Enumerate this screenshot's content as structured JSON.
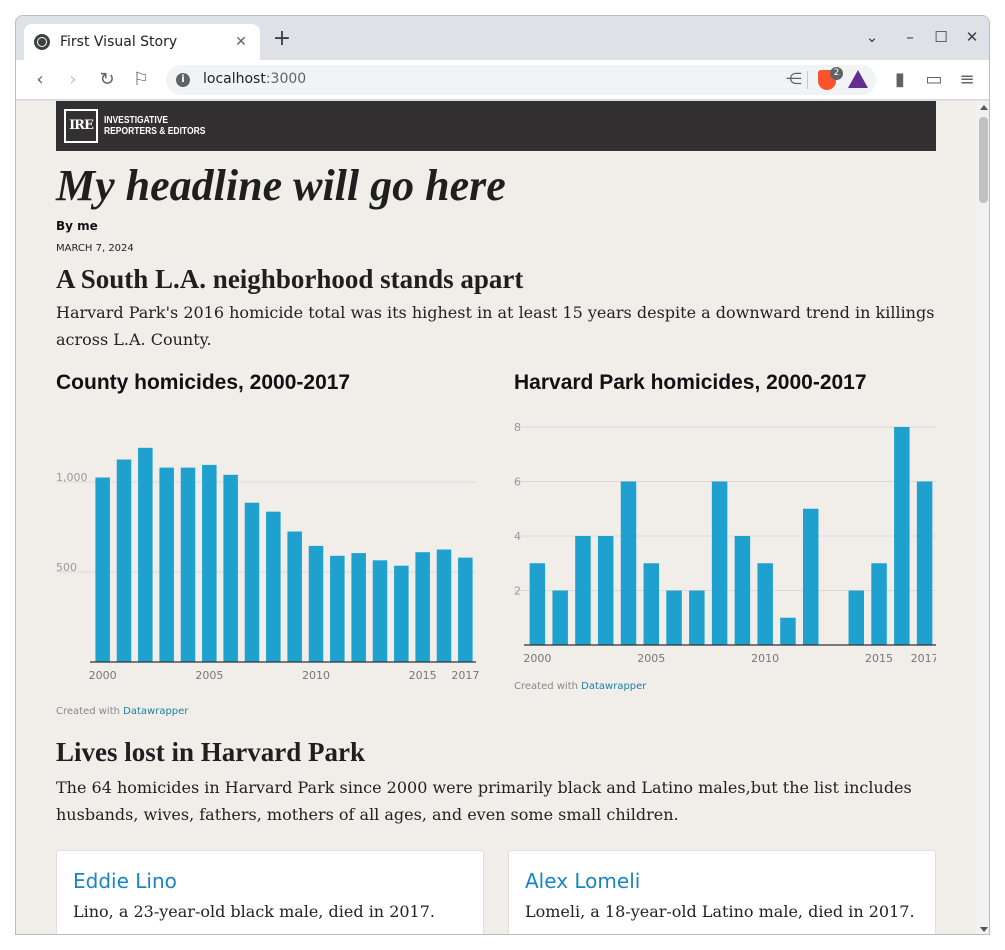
{
  "browser": {
    "tab_title": "First Visual Story",
    "tab_close": "✕",
    "new_tab": "+",
    "url_host": "localhost",
    "url_port": ":3000",
    "brave_badge": "2"
  },
  "masthead": {
    "logo_mark": "IRE",
    "logo_line1": "INVESTIGATIVE",
    "logo_line2": "REPORTERS & EDITORS"
  },
  "article": {
    "headline": "My headline will go here",
    "byline": "By me",
    "date": "MARCH 7, 2024",
    "section1_title": "A South L.A. neighborhood stands apart",
    "section1_text": "Harvard Park's 2016 homicide total was its highest in at least 15 years despite a downward trend in killings across L.A. County.",
    "section2_title": "Lives lost in Harvard Park",
    "section2_text": "The 64 homicides in Harvard Park since 2000 were primarily black and Latino males,but the list includes husbands, wives, fathers, mothers of all ages, and even some small children."
  },
  "credit": {
    "prefix": "Created with ",
    "link": "Datawrapper"
  },
  "cards": [
    {
      "name": "Eddie Lino",
      "desc": "Lino, a 23-year-old black male, died in 2017."
    },
    {
      "name": "Alex Lomeli",
      "desc": "Lomeli, a 18-year-old Latino male, died in 2017."
    }
  ],
  "colors": {
    "bar": "#1fa1cf",
    "page_bg": "#f1eeea",
    "masthead_bg": "#333031",
    "link": "#1a85c2"
  },
  "chart_data": [
    {
      "type": "bar",
      "title": "County homicides, 2000-2017",
      "categories": [
        2000,
        2001,
        2002,
        2003,
        2004,
        2005,
        2006,
        2007,
        2008,
        2009,
        2010,
        2011,
        2012,
        2013,
        2014,
        2015,
        2016,
        2017
      ],
      "values": [
        1025,
        1125,
        1190,
        1080,
        1080,
        1095,
        1040,
        885,
        835,
        725,
        645,
        590,
        605,
        565,
        535,
        610,
        625,
        580
      ],
      "x_tick_labels": [
        "2000",
        "2005",
        "2010",
        "2015",
        "2017"
      ],
      "y_ticks": [
        500,
        1000
      ],
      "y_tick_labels": [
        "500",
        "1,000"
      ],
      "ylim": [
        0,
        1250
      ],
      "grid": true
    },
    {
      "type": "bar",
      "title": "Harvard Park homicides, 2000-2017",
      "categories": [
        2000,
        2001,
        2002,
        2003,
        2004,
        2005,
        2006,
        2007,
        2008,
        2009,
        2010,
        2011,
        2012,
        2013,
        2014,
        2015,
        2016,
        2017
      ],
      "values": [
        3,
        2,
        4,
        4,
        6,
        3,
        2,
        2,
        6,
        4,
        3,
        1,
        5,
        0,
        2,
        3,
        8,
        6
      ],
      "x_tick_labels": [
        "2000",
        "2005",
        "2010",
        "2015",
        "2017"
      ],
      "y_ticks": [
        2,
        4,
        6,
        8
      ],
      "y_tick_labels": [
        "2",
        "4",
        "6",
        "8"
      ],
      "ylim": [
        0,
        8
      ],
      "grid": true
    }
  ]
}
